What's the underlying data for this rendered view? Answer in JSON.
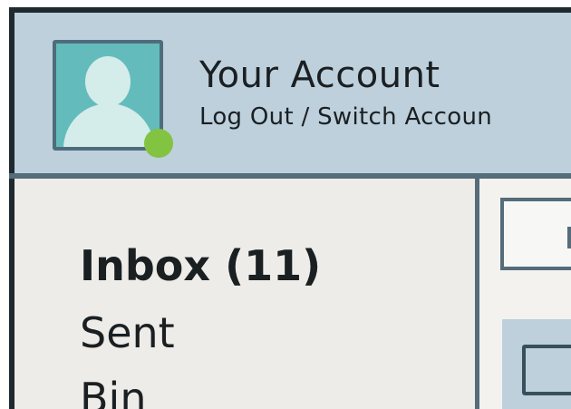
{
  "account": {
    "name": "Your Account",
    "links": "Log Out / Switch Accoun",
    "avatar_icon": "user-silhouette-icon",
    "status": "online",
    "status_color": "#82c341"
  },
  "nav": {
    "items": [
      {
        "label": "Inbox (11)",
        "active": true
      },
      {
        "label": "Sent"
      },
      {
        "label": "Bin"
      }
    ]
  },
  "colors": {
    "header_bg": "#bdd0dc",
    "avatar_bg": "#63bcbb",
    "border": "#556c7a"
  }
}
